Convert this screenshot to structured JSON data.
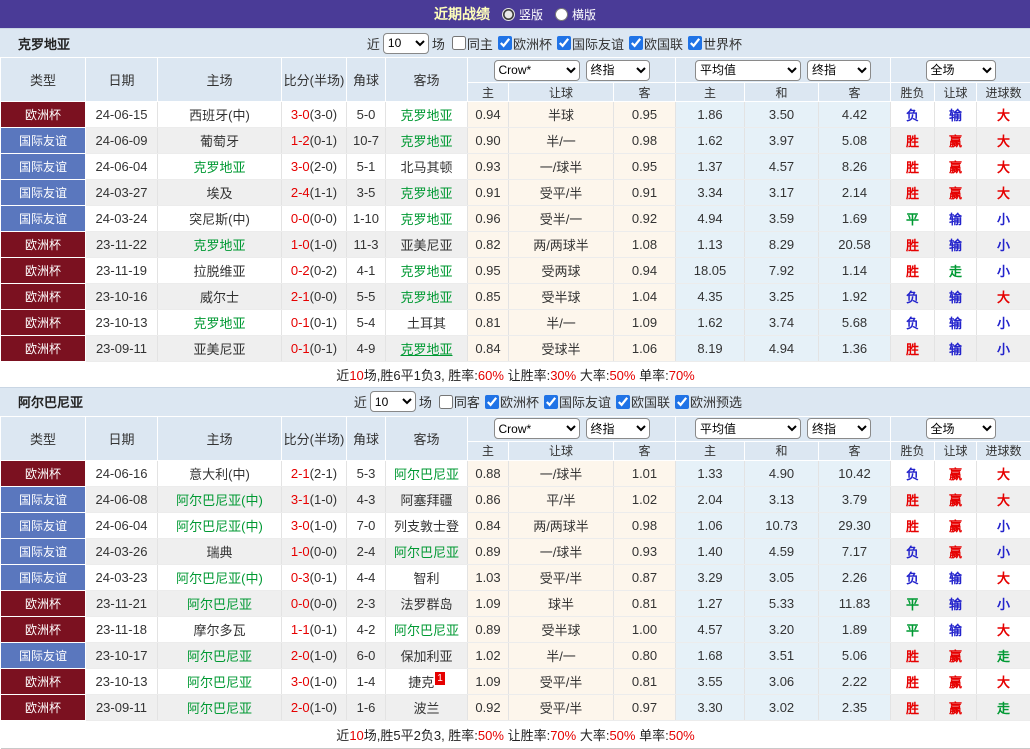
{
  "colors": {
    "purple": "#4a3b97",
    "title": "#ffffbb",
    "hdrbg": "#dce7f2",
    "badge-cup": "#7b1120",
    "badge-friendly": "#5a77be",
    "red": "#e60000",
    "blue": "#2323cc",
    "green": "#009933",
    "cream": "#fdf6ec",
    "lblue": "#e6f1f8",
    "chk": "#2073e6",
    "stripe": "#efefef"
  },
  "topbar": {
    "title": "近期战绩",
    "radio_vertical": "竖版",
    "radio_horizontal": "横版"
  },
  "columns": {
    "type": "类型",
    "date": "日期",
    "home": "主场",
    "score": "比分(半场)",
    "corner": "角球",
    "away": "客场",
    "odds_home": "主",
    "odds_handicap": "让球",
    "odds_away": "客",
    "avg_home": "主",
    "avg_draw": "和",
    "avg_away": "客",
    "result_wl": "胜负",
    "result_handicap": "让球",
    "result_goals": "进球数"
  },
  "dropdowns": {
    "crow": "Crow*",
    "final": "终指",
    "average": "平均值",
    "full": "全场"
  },
  "sections": [
    {
      "team": "克罗地亚",
      "filter": {
        "near": "近",
        "count": "10",
        "games": "场",
        "same": "同主",
        "leagues": [
          "欧洲杯",
          "国际友谊",
          "欧国联",
          "世界杯"
        ]
      },
      "rows": [
        {
          "type": "欧洲杯",
          "tcls": "cup",
          "date": "24-06-15",
          "home": "西班牙(中)",
          "home_green": false,
          "score": "3-0",
          "half": "(3-0)",
          "corner": "5-0",
          "away": "克罗地亚",
          "away_green": true,
          "odds": [
            "0.94",
            "半球",
            "0.95"
          ],
          "avg": [
            "1.86",
            "3.50",
            "4.42"
          ],
          "res": [
            [
              "负",
              "blue"
            ],
            [
              "输",
              "blue"
            ],
            [
              "大",
              "red"
            ]
          ]
        },
        {
          "type": "国际友谊",
          "tcls": "friendly",
          "date": "24-06-09",
          "home": "葡萄牙",
          "home_green": false,
          "score": "1-2",
          "half": "(0-1)",
          "corner": "10-7",
          "away": "克罗地亚",
          "away_green": true,
          "odds": [
            "0.90",
            "半/一",
            "0.98"
          ],
          "avg": [
            "1.62",
            "3.97",
            "5.08"
          ],
          "res": [
            [
              "胜",
              "red"
            ],
            [
              "赢",
              "red"
            ],
            [
              "大",
              "red"
            ]
          ]
        },
        {
          "type": "国际友谊",
          "tcls": "friendly",
          "date": "24-06-04",
          "home": "克罗地亚",
          "home_green": true,
          "score": "3-0",
          "half": "(2-0)",
          "corner": "5-1",
          "away": "北马其顿",
          "away_green": false,
          "odds": [
            "0.93",
            "一/球半",
            "0.95"
          ],
          "avg": [
            "1.37",
            "4.57",
            "8.26"
          ],
          "res": [
            [
              "胜",
              "red"
            ],
            [
              "赢",
              "red"
            ],
            [
              "大",
              "red"
            ]
          ]
        },
        {
          "type": "国际友谊",
          "tcls": "friendly",
          "date": "24-03-27",
          "home": "埃及",
          "home_green": false,
          "score": "2-4",
          "half": "(1-1)",
          "corner": "3-5",
          "away": "克罗地亚",
          "away_green": true,
          "odds": [
            "0.91",
            "受平/半",
            "0.91"
          ],
          "avg": [
            "3.34",
            "3.17",
            "2.14"
          ],
          "res": [
            [
              "胜",
              "red"
            ],
            [
              "赢",
              "red"
            ],
            [
              "大",
              "red"
            ]
          ]
        },
        {
          "type": "国际友谊",
          "tcls": "friendly",
          "date": "24-03-24",
          "home": "突尼斯(中)",
          "home_green": false,
          "score": "0-0",
          "half": "(0-0)",
          "corner": "1-10",
          "away": "克罗地亚",
          "away_green": true,
          "odds": [
            "0.96",
            "受半/一",
            "0.92"
          ],
          "avg": [
            "4.94",
            "3.59",
            "1.69"
          ],
          "res": [
            [
              "平",
              "green"
            ],
            [
              "输",
              "blue"
            ],
            [
              "小",
              "blue"
            ]
          ]
        },
        {
          "type": "欧洲杯",
          "tcls": "cup",
          "date": "23-11-22",
          "home": "克罗地亚",
          "home_green": true,
          "score": "1-0",
          "half": "(1-0)",
          "corner": "11-3",
          "away": "亚美尼亚",
          "away_green": false,
          "odds": [
            "0.82",
            "两/两球半",
            "1.08"
          ],
          "avg": [
            "1.13",
            "8.29",
            "20.58"
          ],
          "res": [
            [
              "胜",
              "red"
            ],
            [
              "输",
              "blue"
            ],
            [
              "小",
              "blue"
            ]
          ]
        },
        {
          "type": "欧洲杯",
          "tcls": "cup",
          "date": "23-11-19",
          "home": "拉脱维亚",
          "home_green": false,
          "score": "0-2",
          "half": "(0-2)",
          "corner": "4-1",
          "away": "克罗地亚",
          "away_green": true,
          "odds": [
            "0.95",
            "受两球",
            "0.94"
          ],
          "avg": [
            "18.05",
            "7.92",
            "1.14"
          ],
          "res": [
            [
              "胜",
              "red"
            ],
            [
              "走",
              "green"
            ],
            [
              "小",
              "blue"
            ]
          ]
        },
        {
          "type": "欧洲杯",
          "tcls": "cup",
          "date": "23-10-16",
          "home": "威尔士",
          "home_green": false,
          "score": "2-1",
          "half": "(0-0)",
          "corner": "5-5",
          "away": "克罗地亚",
          "away_green": true,
          "odds": [
            "0.85",
            "受半球",
            "1.04"
          ],
          "avg": [
            "4.35",
            "3.25",
            "1.92"
          ],
          "res": [
            [
              "负",
              "blue"
            ],
            [
              "输",
              "blue"
            ],
            [
              "大",
              "red"
            ]
          ]
        },
        {
          "type": "欧洲杯",
          "tcls": "cup",
          "date": "23-10-13",
          "home": "克罗地亚",
          "home_green": true,
          "score": "0-1",
          "half": "(0-1)",
          "corner": "5-4",
          "away": "土耳其",
          "away_green": false,
          "odds": [
            "0.81",
            "半/一",
            "1.09"
          ],
          "avg": [
            "1.62",
            "3.74",
            "5.68"
          ],
          "res": [
            [
              "负",
              "blue"
            ],
            [
              "输",
              "blue"
            ],
            [
              "小",
              "blue"
            ]
          ]
        },
        {
          "type": "欧洲杯",
          "tcls": "cup",
          "date": "23-09-11",
          "home": "亚美尼亚",
          "home_green": false,
          "score": "0-1",
          "half": "(0-1)",
          "corner": "4-9",
          "away": "克罗地亚",
          "away_green": true,
          "away_underline": true,
          "odds": [
            "0.84",
            "受球半",
            "1.06"
          ],
          "avg": [
            "8.19",
            "4.94",
            "1.36"
          ],
          "res": [
            [
              "胜",
              "red"
            ],
            [
              "输",
              "blue"
            ],
            [
              "小",
              "blue"
            ]
          ]
        }
      ],
      "summary": [
        {
          "t": "近"
        },
        {
          "t": "10",
          "c": "red"
        },
        {
          "t": "场,胜6平1负3, 胜率:"
        },
        {
          "t": "60%",
          "c": "red"
        },
        {
          "t": " 让胜率:"
        },
        {
          "t": "30%",
          "c": "red"
        },
        {
          "t": " 大率:"
        },
        {
          "t": "50%",
          "c": "red"
        },
        {
          "t": " 单率:"
        },
        {
          "t": "70%",
          "c": "red"
        }
      ]
    },
    {
      "team": "阿尔巴尼亚",
      "filter": {
        "near": "近",
        "count": "10",
        "games": "场",
        "same": "同客",
        "leagues": [
          "欧洲杯",
          "国际友谊",
          "欧国联",
          "欧洲预选"
        ]
      },
      "rows": [
        {
          "type": "欧洲杯",
          "tcls": "cup",
          "date": "24-06-16",
          "home": "意大利(中)",
          "home_green": false,
          "score": "2-1",
          "half": "(2-1)",
          "corner": "5-3",
          "away": "阿尔巴尼亚",
          "away_green": true,
          "odds": [
            "0.88",
            "一/球半",
            "1.01"
          ],
          "avg": [
            "1.33",
            "4.90",
            "10.42"
          ],
          "res": [
            [
              "负",
              "blue"
            ],
            [
              "赢",
              "red"
            ],
            [
              "大",
              "red"
            ]
          ]
        },
        {
          "type": "国际友谊",
          "tcls": "friendly",
          "date": "24-06-08",
          "home": "阿尔巴尼亚(中)",
          "home_green": true,
          "score": "3-1",
          "half": "(1-0)",
          "corner": "4-3",
          "away": "阿塞拜疆",
          "away_green": false,
          "odds": [
            "0.86",
            "平/半",
            "1.02"
          ],
          "avg": [
            "2.04",
            "3.13",
            "3.79"
          ],
          "res": [
            [
              "胜",
              "red"
            ],
            [
              "赢",
              "red"
            ],
            [
              "大",
              "red"
            ]
          ]
        },
        {
          "type": "国际友谊",
          "tcls": "friendly",
          "date": "24-06-04",
          "home": "阿尔巴尼亚(中)",
          "home_green": true,
          "score": "3-0",
          "half": "(1-0)",
          "corner": "7-0",
          "away": "列支敦士登",
          "away_green": false,
          "odds": [
            "0.84",
            "两/两球半",
            "0.98"
          ],
          "avg": [
            "1.06",
            "10.73",
            "29.30"
          ],
          "res": [
            [
              "胜",
              "red"
            ],
            [
              "赢",
              "red"
            ],
            [
              "小",
              "blue"
            ]
          ]
        },
        {
          "type": "国际友谊",
          "tcls": "friendly",
          "date": "24-03-26",
          "home": "瑞典",
          "home_green": false,
          "score": "1-0",
          "half": "(0-0)",
          "corner": "2-4",
          "away": "阿尔巴尼亚",
          "away_green": true,
          "odds": [
            "0.89",
            "一/球半",
            "0.93"
          ],
          "avg": [
            "1.40",
            "4.59",
            "7.17"
          ],
          "res": [
            [
              "负",
              "blue"
            ],
            [
              "赢",
              "red"
            ],
            [
              "小",
              "blue"
            ]
          ]
        },
        {
          "type": "国际友谊",
          "tcls": "friendly",
          "date": "24-03-23",
          "home": "阿尔巴尼亚(中)",
          "home_green": true,
          "score": "0-3",
          "half": "(0-1)",
          "corner": "4-4",
          "away": "智利",
          "away_green": false,
          "odds": [
            "1.03",
            "受平/半",
            "0.87"
          ],
          "avg": [
            "3.29",
            "3.05",
            "2.26"
          ],
          "res": [
            [
              "负",
              "blue"
            ],
            [
              "输",
              "blue"
            ],
            [
              "大",
              "red"
            ]
          ]
        },
        {
          "type": "欧洲杯",
          "tcls": "cup",
          "date": "23-11-21",
          "home": "阿尔巴尼亚",
          "home_green": true,
          "score": "0-0",
          "half": "(0-0)",
          "corner": "2-3",
          "away": "法罗群岛",
          "away_green": false,
          "odds": [
            "1.09",
            "球半",
            "0.81"
          ],
          "avg": [
            "1.27",
            "5.33",
            "11.83"
          ],
          "res": [
            [
              "平",
              "green"
            ],
            [
              "输",
              "blue"
            ],
            [
              "小",
              "blue"
            ]
          ]
        },
        {
          "type": "欧洲杯",
          "tcls": "cup",
          "date": "23-11-18",
          "home": "摩尔多瓦",
          "home_green": false,
          "score": "1-1",
          "half": "(0-1)",
          "corner": "4-2",
          "away": "阿尔巴尼亚",
          "away_green": true,
          "odds": [
            "0.89",
            "受半球",
            "1.00"
          ],
          "avg": [
            "4.57",
            "3.20",
            "1.89"
          ],
          "res": [
            [
              "平",
              "green"
            ],
            [
              "输",
              "blue"
            ],
            [
              "大",
              "red"
            ]
          ]
        },
        {
          "type": "国际友谊",
          "tcls": "friendly",
          "date": "23-10-17",
          "home": "阿尔巴尼亚",
          "home_green": true,
          "score": "2-0",
          "half": "(1-0)",
          "corner": "6-0",
          "away": "保加利亚",
          "away_green": false,
          "odds": [
            "1.02",
            "半/一",
            "0.80"
          ],
          "avg": [
            "1.68",
            "3.51",
            "5.06"
          ],
          "res": [
            [
              "胜",
              "red"
            ],
            [
              "赢",
              "red"
            ],
            [
              "走",
              "green"
            ]
          ]
        },
        {
          "type": "欧洲杯",
          "tcls": "cup",
          "date": "23-10-13",
          "home": "阿尔巴尼亚",
          "home_green": true,
          "score": "3-0",
          "half": "(1-0)",
          "corner": "1-4",
          "away": "捷克",
          "away_green": false,
          "away_sup": "1",
          "odds": [
            "1.09",
            "受平/半",
            "0.81"
          ],
          "avg": [
            "3.55",
            "3.06",
            "2.22"
          ],
          "res": [
            [
              "胜",
              "red"
            ],
            [
              "赢",
              "red"
            ],
            [
              "大",
              "red"
            ]
          ]
        },
        {
          "type": "欧洲杯",
          "tcls": "cup",
          "date": "23-09-11",
          "home": "阿尔巴尼亚",
          "home_green": true,
          "score": "2-0",
          "half": "(1-0)",
          "corner": "1-6",
          "away": "波兰",
          "away_green": false,
          "odds": [
            "0.92",
            "受平/半",
            "0.97"
          ],
          "avg": [
            "3.30",
            "3.02",
            "2.35"
          ],
          "res": [
            [
              "胜",
              "red"
            ],
            [
              "赢",
              "red"
            ],
            [
              "走",
              "green"
            ]
          ]
        }
      ],
      "summary": [
        {
          "t": "近"
        },
        {
          "t": "10",
          "c": "red"
        },
        {
          "t": "场,胜5平2负3, 胜率:"
        },
        {
          "t": "50%",
          "c": "red"
        },
        {
          "t": " 让胜率:"
        },
        {
          "t": "70%",
          "c": "red"
        },
        {
          "t": " 大率:"
        },
        {
          "t": "50%",
          "c": "red"
        },
        {
          "t": " 单率:"
        },
        {
          "t": "50%",
          "c": "red"
        }
      ]
    }
  ]
}
